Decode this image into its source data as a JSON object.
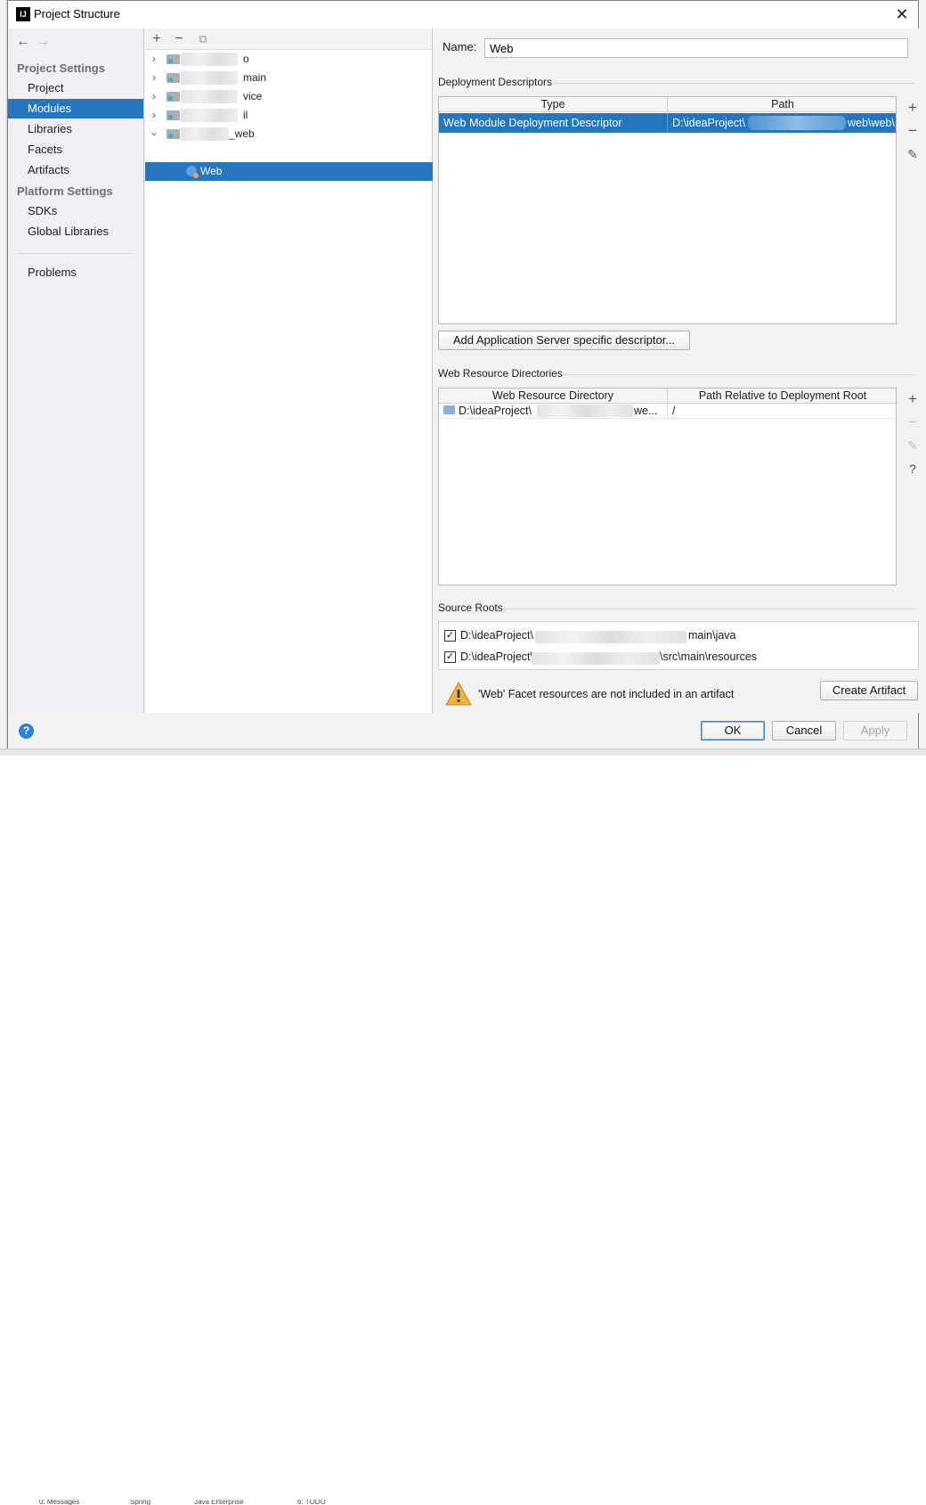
{
  "window": {
    "title": "Project Structure"
  },
  "nav": {
    "project_settings": "Project Settings",
    "platform_settings": "Platform Settings",
    "items": [
      {
        "label": "Project"
      },
      {
        "label": "Modules"
      },
      {
        "label": "Libraries"
      },
      {
        "label": "Facets"
      },
      {
        "label": "Artifacts"
      },
      {
        "label": "SDKs"
      },
      {
        "label": "Global Libraries"
      },
      {
        "label": "Problems"
      }
    ]
  },
  "tree": {
    "rows": [
      {
        "suffix": "o"
      },
      {
        "suffix": "main"
      },
      {
        "suffix": "vice"
      },
      {
        "suffix": "il"
      },
      {
        "suffix": "_web"
      },
      {
        "suffix": "Web"
      }
    ]
  },
  "content": {
    "name_label": "Name:",
    "name_value": "Web",
    "deployment_descriptors": {
      "title": "Deployment Descriptors",
      "columns": [
        "Type",
        "Path"
      ],
      "rows": [
        {
          "type": "Web Module Deployment Descriptor",
          "path_start": "D:\\ideaProject\\",
          "path_end": "web\\web\\"
        }
      ]
    },
    "add_server_button": "Add Application Server specific descriptor...",
    "web_resource_dirs": {
      "title": "Web Resource Directories",
      "columns": [
        "Web Resource Directory",
        "Path Relative to Deployment Root"
      ],
      "rows": [
        {
          "dir_start": "D:\\ideaProject\\",
          "dir_end": "we...",
          "relative": "/"
        }
      ]
    },
    "source_roots": {
      "title": "Source Roots",
      "items": [
        {
          "start": "D:\\ideaProject\\",
          "end": "main\\java",
          "checked": true
        },
        {
          "start": "D:\\ideaProject\\",
          "end": "\\src\\main\\resources",
          "checked": true
        }
      ]
    },
    "warning": "'Web' Facet resources are not included in an artifact",
    "create_artifact": "Create Artifact"
  },
  "buttons": {
    "ok": "OK",
    "cancel": "Cancel",
    "apply": "Apply"
  },
  "background_bar": [
    "0: Messages",
    "Spring",
    "Java Enterprise",
    "6: TODO"
  ]
}
